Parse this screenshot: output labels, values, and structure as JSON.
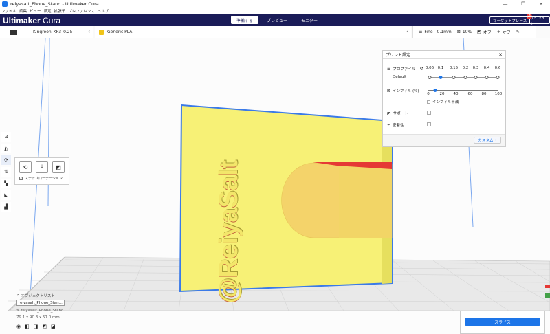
{
  "window": {
    "title": "reiyasalt_Phone_Stand - Ultimaker Cura",
    "min": "—",
    "max": "❐",
    "close": "✕"
  },
  "menu": [
    "ファイル",
    "編集",
    "ビュー",
    "設定",
    "拡張子",
    "プレファレンス",
    "ヘルプ"
  ],
  "header": {
    "logo_main": "Ultimaker",
    "logo_sub": " Cura",
    "stages": [
      "準備する",
      "プレビュー",
      "モニター"
    ],
    "marketplace": "マーケットプレース",
    "marketplace_badge": "2",
    "signin": "サインイン"
  },
  "toolbar": {
    "machine": "Kingroon_KP3_0.25",
    "material": "Generic PLA",
    "profile": "Fine - 0.1mm",
    "infill": "10%",
    "support": "オフ",
    "adhesion": "オフ"
  },
  "print_settings": {
    "title": "プリント設定",
    "profile_label": "プロファイル",
    "profile_value": "Default",
    "layer_ticks": [
      "0.06",
      "0.1",
      "0.15",
      "0.2",
      "0.3",
      "0.4",
      "0.6"
    ],
    "infill_label": "インフィル (%)",
    "infill_ticks": [
      "0",
      "20",
      "40",
      "60",
      "80",
      "100"
    ],
    "gradual_label": "インフィル半減",
    "support_label": "サポート",
    "adhesion_label": "密着性",
    "custom_button": "カスタム"
  },
  "rotate": {
    "snap_label": "スナップローテーション"
  },
  "model": {
    "embossed_text": "@ReiyaSalt"
  },
  "objects": {
    "header": "オブジェクトリスト",
    "field_value": "reiyasalt_Phone_Stan...",
    "name": "reiyasalt_Phone_Stand",
    "dimensions": "79.1 x 90.3 x 57.0 mm"
  },
  "slice": {
    "label": "スライス"
  },
  "colors": {
    "accent": "#1d75e8",
    "header_bg": "#1a1c58",
    "model": "#f9f178"
  }
}
